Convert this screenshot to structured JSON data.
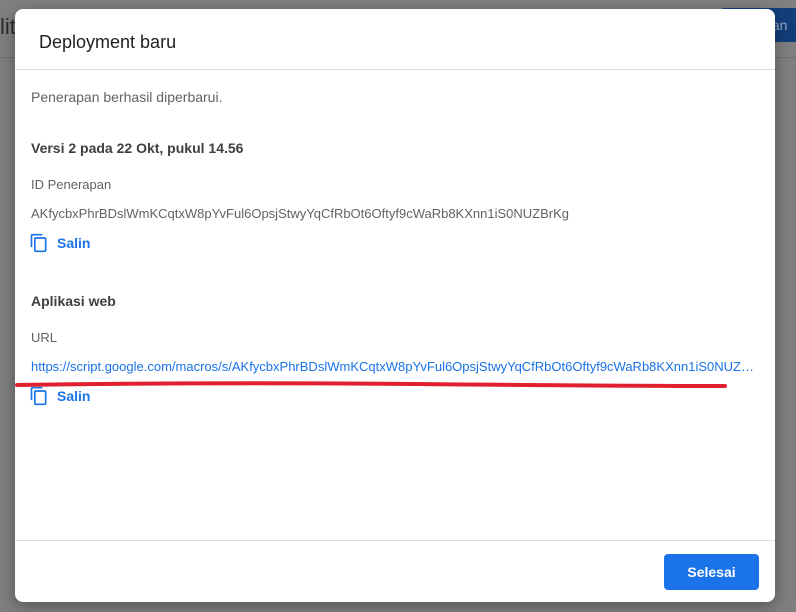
{
  "background": {
    "title_fragment": "lit",
    "deploy_button_label": "tan"
  },
  "modal": {
    "title": "Deployment baru",
    "success_message": "Penerapan berhasil diperbarui.",
    "version_title": "Versi 2 pada 22 Okt, pukul 14.56",
    "deployment_id": {
      "label": "ID Penerapan",
      "value": "AKfycbxPhrBDslWmKCqtxW8pYvFul6OpsjStwyYqCfRbOt6Oftyf9cWaRb8KXnn1iS0NUZBrKg",
      "copy_label": "Salin"
    },
    "web_app": {
      "section_title": "Aplikasi web",
      "url_label": "URL",
      "url_value": "https://script.google.com/macros/s/AKfycbxPhrBDslWmKCqtxW8pYvFul6OpsjStwyYqCfRbOt6Oftyf9cWaRb8KXnn1iS0NUZBrKg/exec",
      "copy_label": "Salin"
    },
    "done_label": "Selesai"
  },
  "colors": {
    "accent": "#1a73e8",
    "annotation": "#e0202e"
  },
  "icons": {
    "copy": "copy-icon"
  }
}
